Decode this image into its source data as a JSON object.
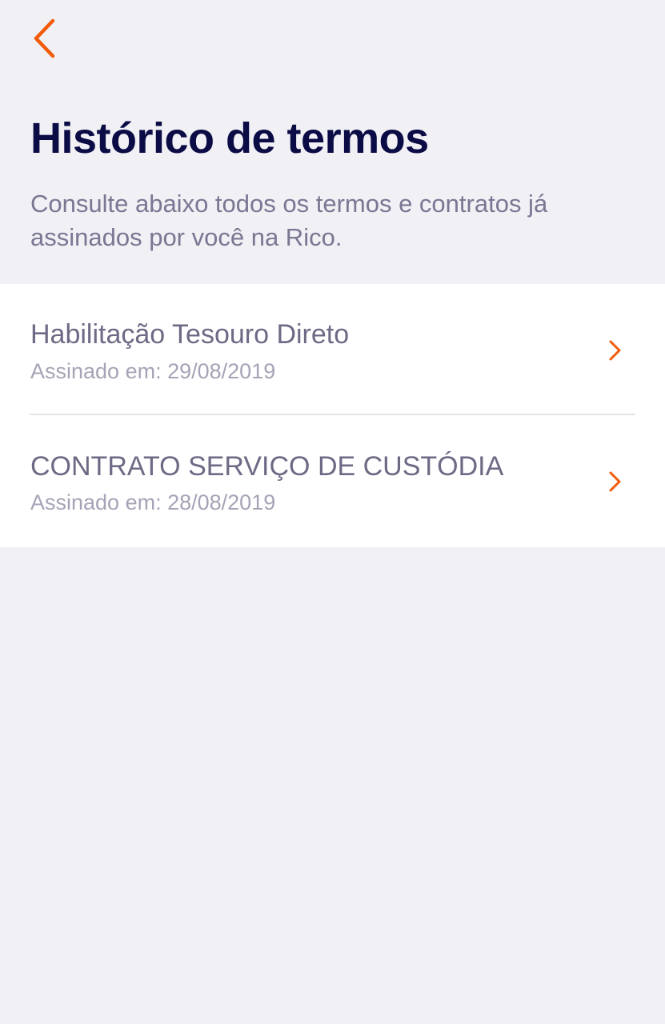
{
  "header": {
    "back_icon": "chevron-left-icon",
    "title": "Histórico de termos",
    "subtitle": "Consulte abaixo todos os termos e contratos já assinados por você na Rico."
  },
  "terms": [
    {
      "title": "Habilitação Tesouro Direto",
      "signed": "Assinado em: 29/08/2019",
      "icon": "chevron-right-icon"
    },
    {
      "title": "CONTRATO SERVIÇO DE CUSTÓDIA",
      "signed": "Assinado em: 28/08/2019",
      "icon": "chevron-right-icon"
    }
  ],
  "colors": {
    "accent": "#f25b0a",
    "title": "#0b0b45",
    "text": "#6c6a85",
    "muted": "#a5a4b6",
    "background": "#f0f0f5",
    "card": "#ffffff"
  }
}
